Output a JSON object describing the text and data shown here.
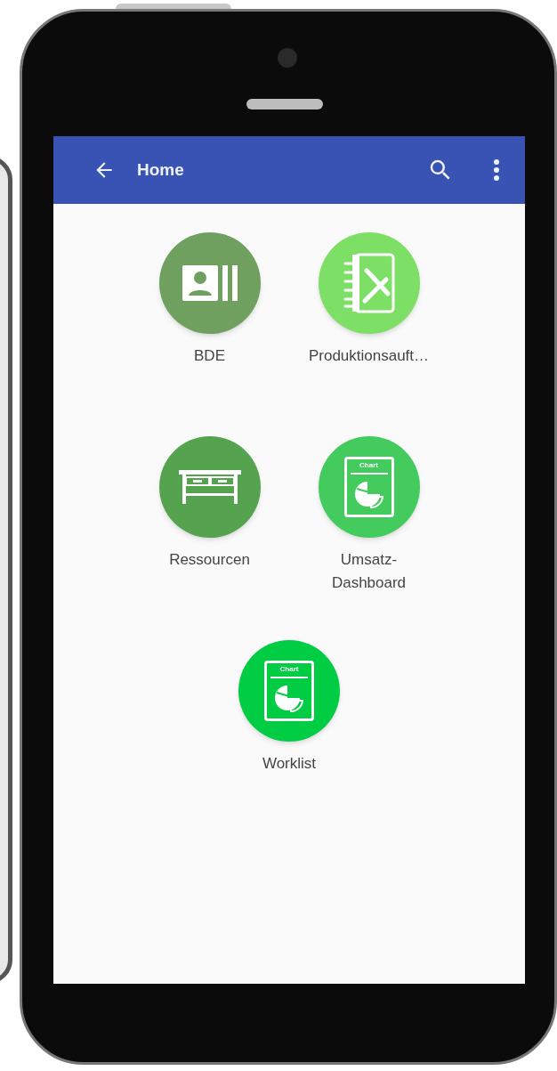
{
  "app_bar": {
    "title": "Home"
  },
  "tiles": [
    {
      "label": "BDE",
      "kind": "id-card",
      "color": "#6fa060"
    },
    {
      "label": "Produktionsauft…",
      "kind": "manual-tools",
      "color": "#7ddf66"
    },
    {
      "label": "Ressourcen",
      "kind": "workbench",
      "color": "#55a34e"
    },
    {
      "label": "Umsatz-\nDashboard",
      "kind": "chart-doc",
      "color": "#43cc5d",
      "icon_text": "Chart"
    },
    {
      "label": "Worklist",
      "kind": "chart-doc",
      "color": "#00cc44",
      "icon_text": "Chart"
    }
  ]
}
